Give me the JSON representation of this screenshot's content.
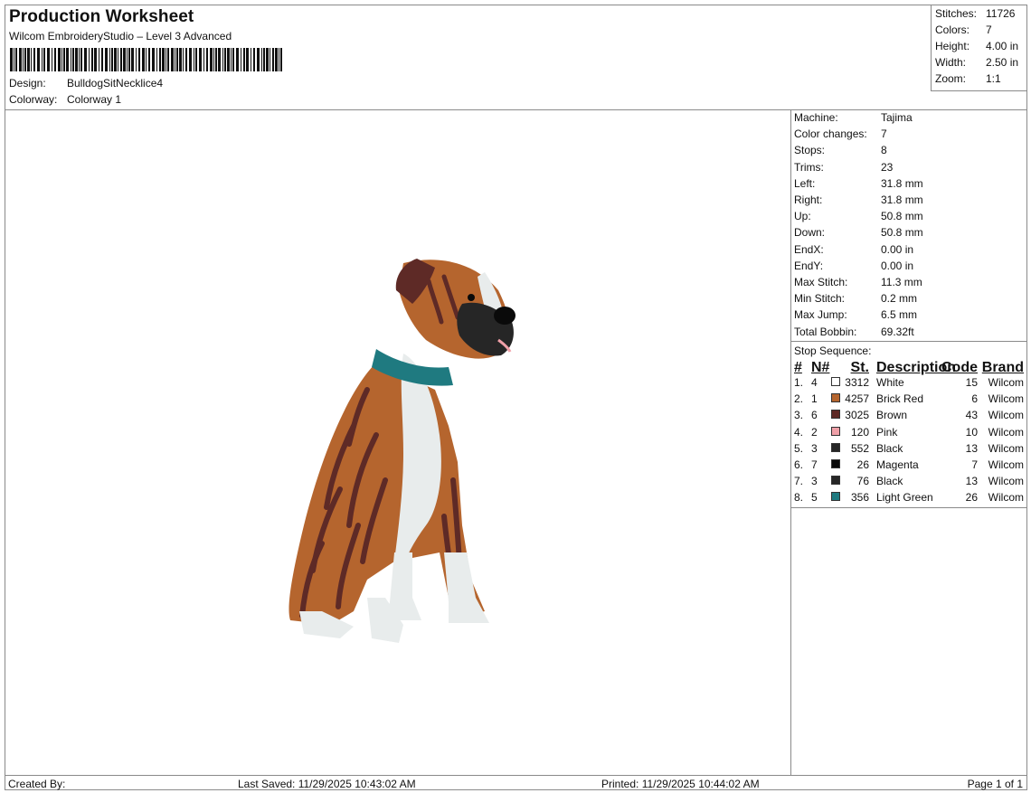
{
  "header": {
    "title": "Production Worksheet",
    "subtitle": "Wilcom EmbroideryStudio – Level 3 Advanced",
    "design_label": "Design:",
    "design_value": "BulldogSitNecklice4",
    "colorway_label": "Colorway:",
    "colorway_value": "Colorway 1"
  },
  "stats": [
    {
      "label": "Stitches:",
      "value": "11726"
    },
    {
      "label": "Colors:",
      "value": "7"
    },
    {
      "label": "Height:",
      "value": "4.00 in"
    },
    {
      "label": "Width:",
      "value": "2.50 in"
    },
    {
      "label": "Zoom:",
      "value": "1:1"
    }
  ],
  "machine_info": [
    {
      "label": "Machine:",
      "value": "Tajima"
    },
    {
      "label": "Color changes:",
      "value": "7"
    },
    {
      "label": "Stops:",
      "value": "8"
    },
    {
      "label": "Trims:",
      "value": "23"
    },
    {
      "label": "Left:",
      "value": "31.8 mm"
    },
    {
      "label": "Right:",
      "value": "31.8 mm"
    },
    {
      "label": "Up:",
      "value": "50.8 mm"
    },
    {
      "label": "Down:",
      "value": "50.8 mm"
    },
    {
      "label": "EndX:",
      "value": "0.00 in"
    },
    {
      "label": "EndY:",
      "value": "0.00 in"
    },
    {
      "label": "Max Stitch:",
      "value": "11.3 mm"
    },
    {
      "label": "Min Stitch:",
      "value": "0.2 mm"
    },
    {
      "label": "Max Jump:",
      "value": "6.5 mm"
    },
    {
      "label": "Total Bobbin:",
      "value": "69.32ft"
    }
  ],
  "stop_sequence": {
    "title": "Stop Sequence:",
    "headers": {
      "num": "#",
      "n": "N#",
      "st": "St.",
      "description": "Description",
      "code": "Code",
      "brand": "Brand"
    },
    "rows": [
      {
        "num": "1.",
        "n": "4",
        "color": "#ffffff",
        "st": "3312",
        "description": "White",
        "code": "15",
        "brand": "Wilcom"
      },
      {
        "num": "2.",
        "n": "1",
        "color": "#b5652e",
        "st": "4257",
        "description": "Brick Red",
        "code": "6",
        "brand": "Wilcom"
      },
      {
        "num": "3.",
        "n": "6",
        "color": "#5e2a26",
        "st": "3025",
        "description": "Brown",
        "code": "43",
        "brand": "Wilcom"
      },
      {
        "num": "4.",
        "n": "2",
        "color": "#f0a0a8",
        "st": "120",
        "description": "Pink",
        "code": "10",
        "brand": "Wilcom"
      },
      {
        "num": "5.",
        "n": "3",
        "color": "#262626",
        "st": "552",
        "description": "Black",
        "code": "13",
        "brand": "Wilcom"
      },
      {
        "num": "6.",
        "n": "7",
        "color": "#0a0a0a",
        "st": "26",
        "description": "Magenta",
        "code": "7",
        "brand": "Wilcom"
      },
      {
        "num": "7.",
        "n": "3",
        "color": "#262626",
        "st": "76",
        "description": "Black",
        "code": "13",
        "brand": "Wilcom"
      },
      {
        "num": "8.",
        "n": "5",
        "color": "#1f7a80",
        "st": "356",
        "description": "Light Green",
        "code": "26",
        "brand": "Wilcom"
      }
    ]
  },
  "footer": {
    "created_by": "Created By:",
    "last_saved": "Last Saved: 11/29/2025 10:43:02 AM",
    "printed": "Printed: 11/29/2025 10:44:02 AM",
    "page": "Page 1 of 1"
  },
  "design_image": {
    "icon": "boxer-dog-embroidery",
    "colors": {
      "tan": "#b5652e",
      "brown": "#5e2a26",
      "white": "#e8ecec",
      "collar": "#1f7a80",
      "black": "#262626"
    }
  }
}
